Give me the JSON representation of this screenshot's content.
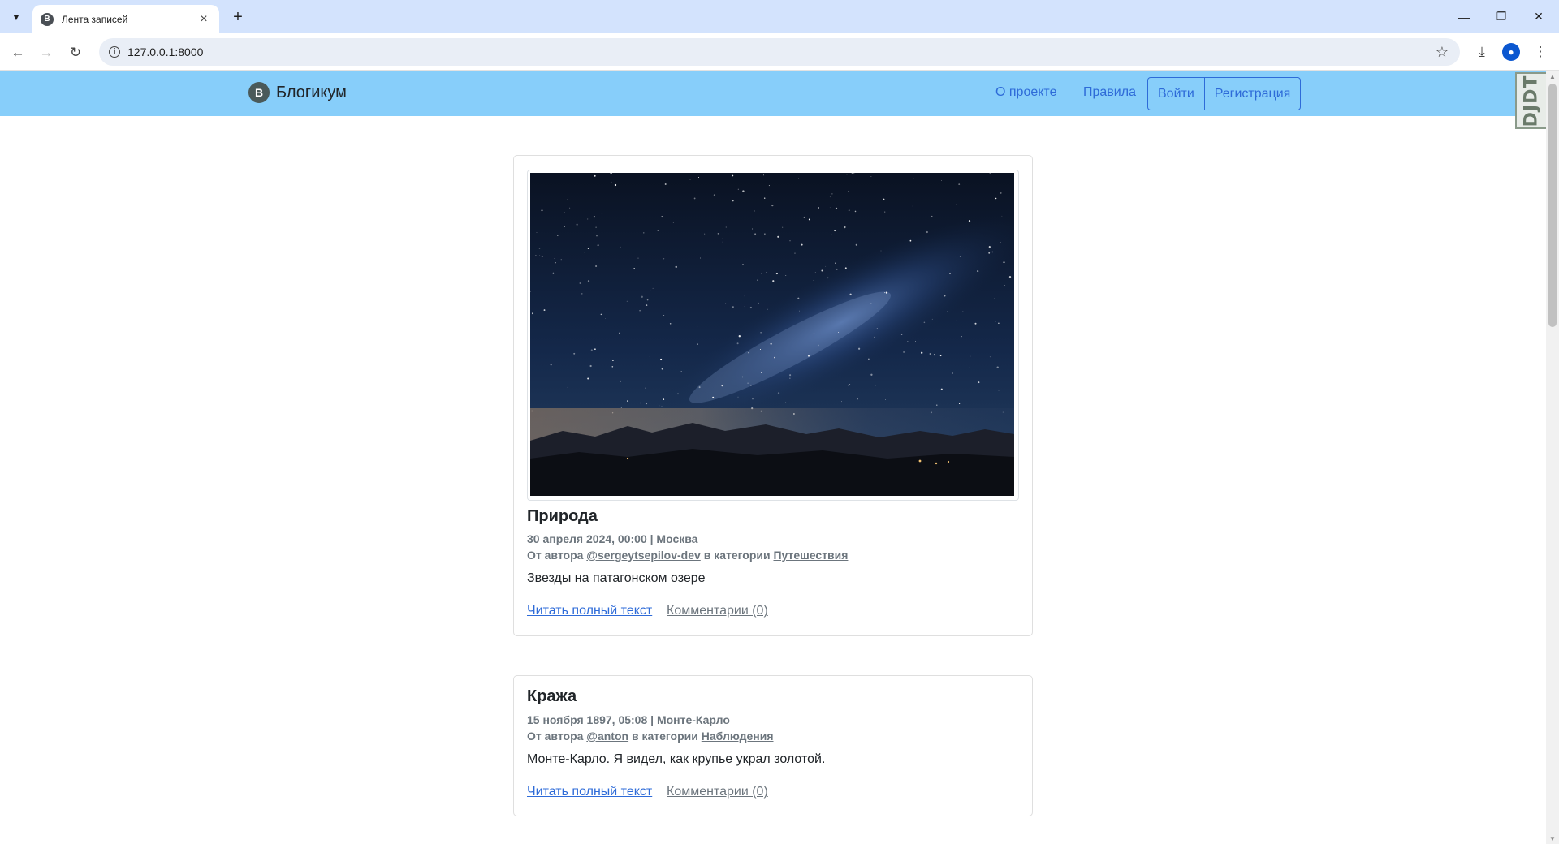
{
  "browser": {
    "tab_title": "Лента записей",
    "url": "127.0.0.1:8000",
    "favicon_letter": "B"
  },
  "site": {
    "brand": "Блогикум",
    "brand_logo_letter": "B",
    "nav": {
      "about": "О проекте",
      "rules": "Правила",
      "login": "Войти",
      "register": "Регистрация"
    },
    "extension_badge": "DJDT"
  },
  "posts": [
    {
      "title": "Природа",
      "date_location": "30 апреля 2024, 00:00 | Москва",
      "author_prefix": "От автора",
      "author": "@sergeytsepilov-dev",
      "category_prefix": "в категории",
      "category": "Путешествия",
      "text": "Звезды на патагонском озере",
      "read_more": "Читать полный текст",
      "comments": "Комментарии (0)",
      "has_image": true
    },
    {
      "title": "Кража",
      "date_location": "15 ноября 1897, 05:08 | Монте-Карло",
      "author_prefix": "От автора",
      "author": "@anton",
      "category_prefix": "в категории",
      "category": "Наблюдения",
      "text": "Монте-Карло. Я видел, как крупье украл золотой.",
      "read_more": "Читать полный текст",
      "comments": "Комментарии (0)",
      "has_image": false
    }
  ],
  "colors": {
    "header_bg": "#87cefa",
    "link": "#2e6bd8",
    "muted": "#6c757d",
    "tabstrip": "#d3e3fd"
  }
}
